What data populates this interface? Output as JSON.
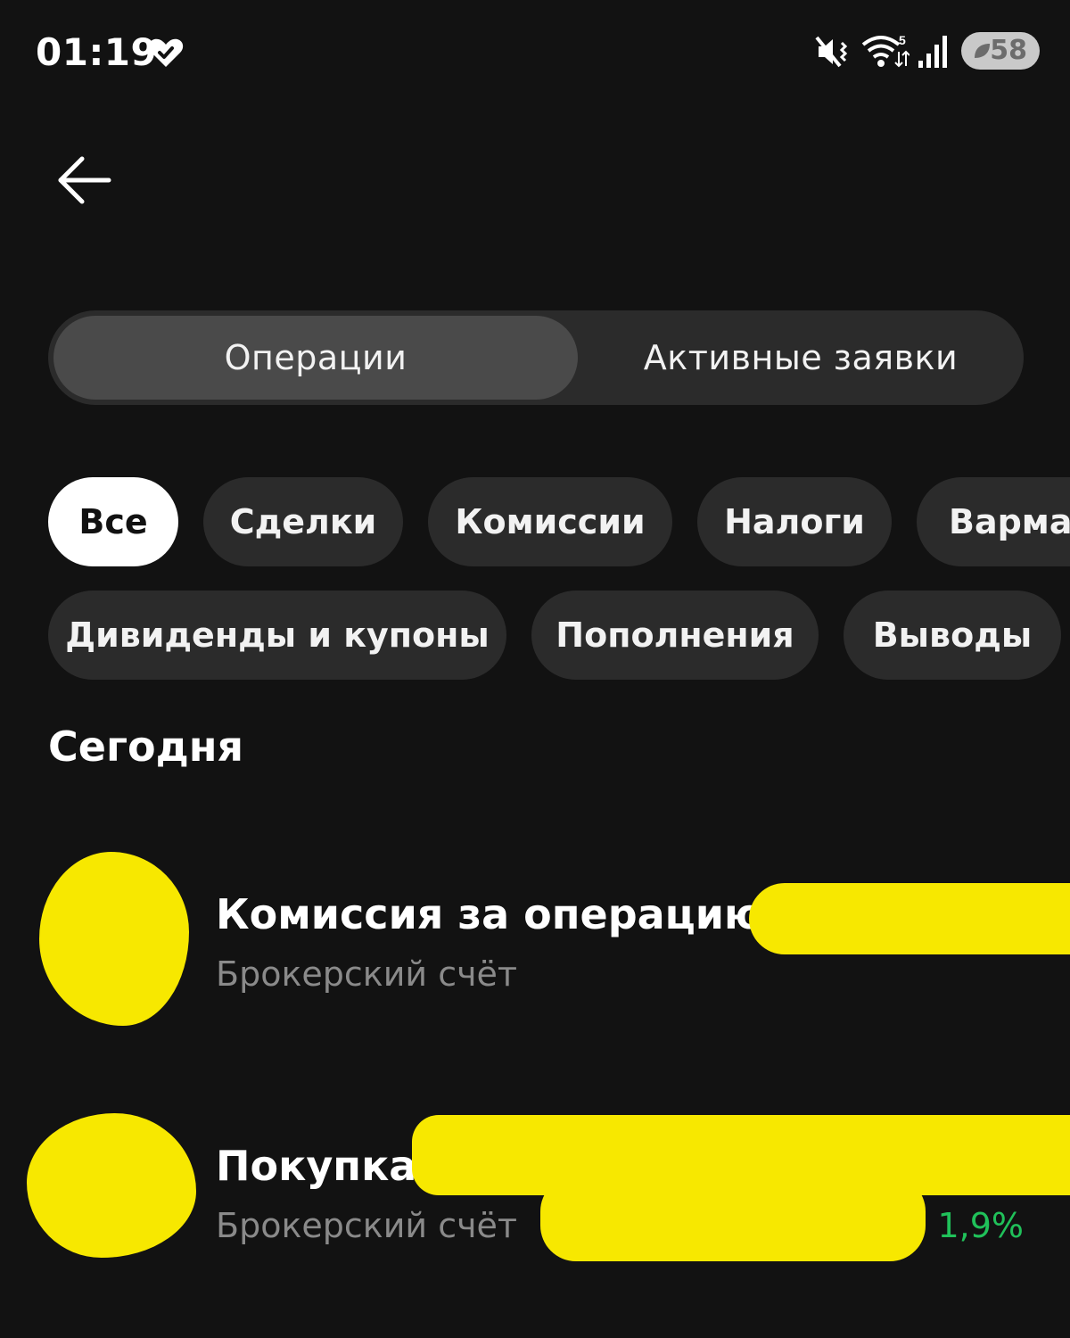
{
  "status_bar": {
    "time": "01:19",
    "battery": "58",
    "icons": [
      "heart-icon",
      "mute-vibrate-icon",
      "wifi-icon",
      "signal-icon",
      "battery-icon"
    ]
  },
  "header": {
    "back_icon": "arrow-left-icon"
  },
  "segmented": {
    "tabs": [
      {
        "label": "Операции",
        "active": true
      },
      {
        "label": "Активные заявки",
        "active": false
      }
    ]
  },
  "filters": {
    "chips": [
      {
        "label": "Все",
        "selected": true
      },
      {
        "label": "Сделки",
        "selected": false
      },
      {
        "label": "Комиссии",
        "selected": false
      },
      {
        "label": "Налоги",
        "selected": false
      },
      {
        "label": "Вармар",
        "selected": false
      },
      {
        "label": "Дивиденды и купоны",
        "selected": false
      },
      {
        "label": "Пополнения",
        "selected": false
      },
      {
        "label": "Выводы",
        "selected": false
      }
    ]
  },
  "section": {
    "title": "Сегодня"
  },
  "operations": [
    {
      "title": "Комиссия за операцию",
      "subtitle": "Брокерский счёт",
      "change": ""
    },
    {
      "title": "Покупка",
      "subtitle": "Брокерский счёт",
      "change": "1,9%"
    }
  ],
  "colors": {
    "background": "#121212",
    "chip": "#2b2b2b",
    "chip_selected": "#ffffff",
    "positive": "#20c15a",
    "redaction": "#f7e800"
  }
}
